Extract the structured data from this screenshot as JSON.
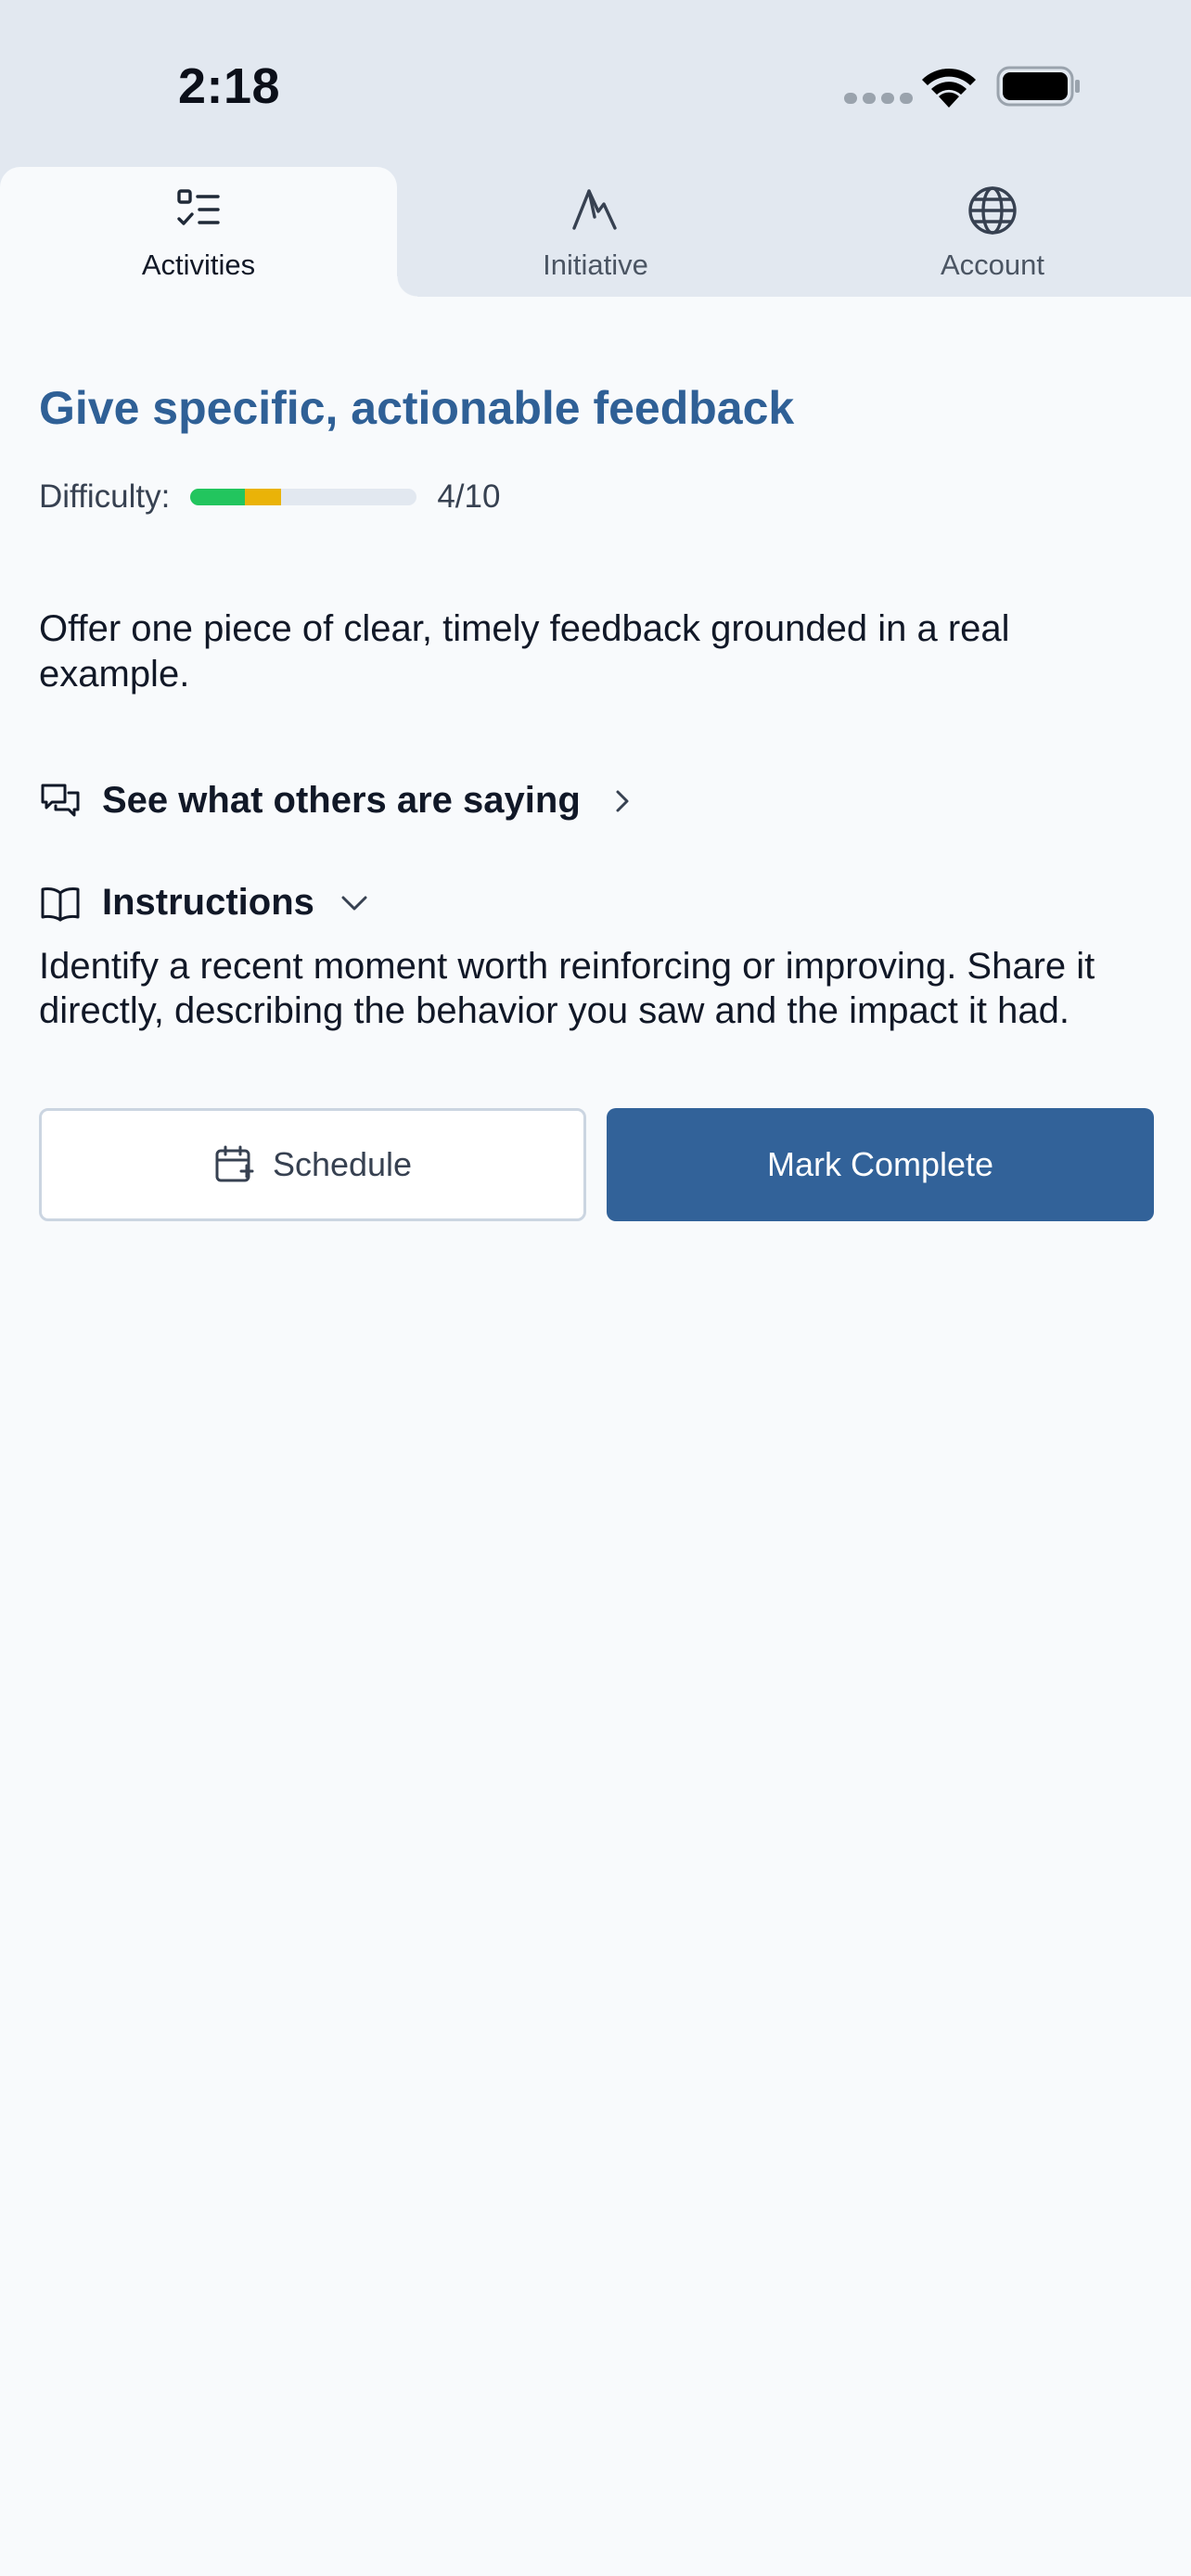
{
  "status_bar": {
    "time": "2:18"
  },
  "tabs": [
    {
      "label": "Activities",
      "icon": "list-check-icon",
      "active": true
    },
    {
      "label": "Initiative",
      "icon": "mountain-icon",
      "active": false
    },
    {
      "label": "Account",
      "icon": "globe-icon",
      "active": false
    }
  ],
  "activity": {
    "title": "Give specific, actionable feedback",
    "difficulty_label": "Difficulty:",
    "difficulty_value": "4/10",
    "difficulty_fraction": 0.4,
    "description": "Offer one piece of clear, timely feedback grounded in a real example.",
    "others_label": "See what others are saying",
    "instructions_label": "Instructions",
    "instructions_text": "Identify a recent moment worth reinforcing or improving. Share it directly, describing the behavior you saw and the impact it had."
  },
  "actions": {
    "schedule_label": "Schedule",
    "complete_label": "Mark Complete"
  },
  "colors": {
    "accent": "#326299",
    "title": "#2f6096",
    "difficulty_low": "#22c55e",
    "difficulty_mid": "#eab308"
  }
}
